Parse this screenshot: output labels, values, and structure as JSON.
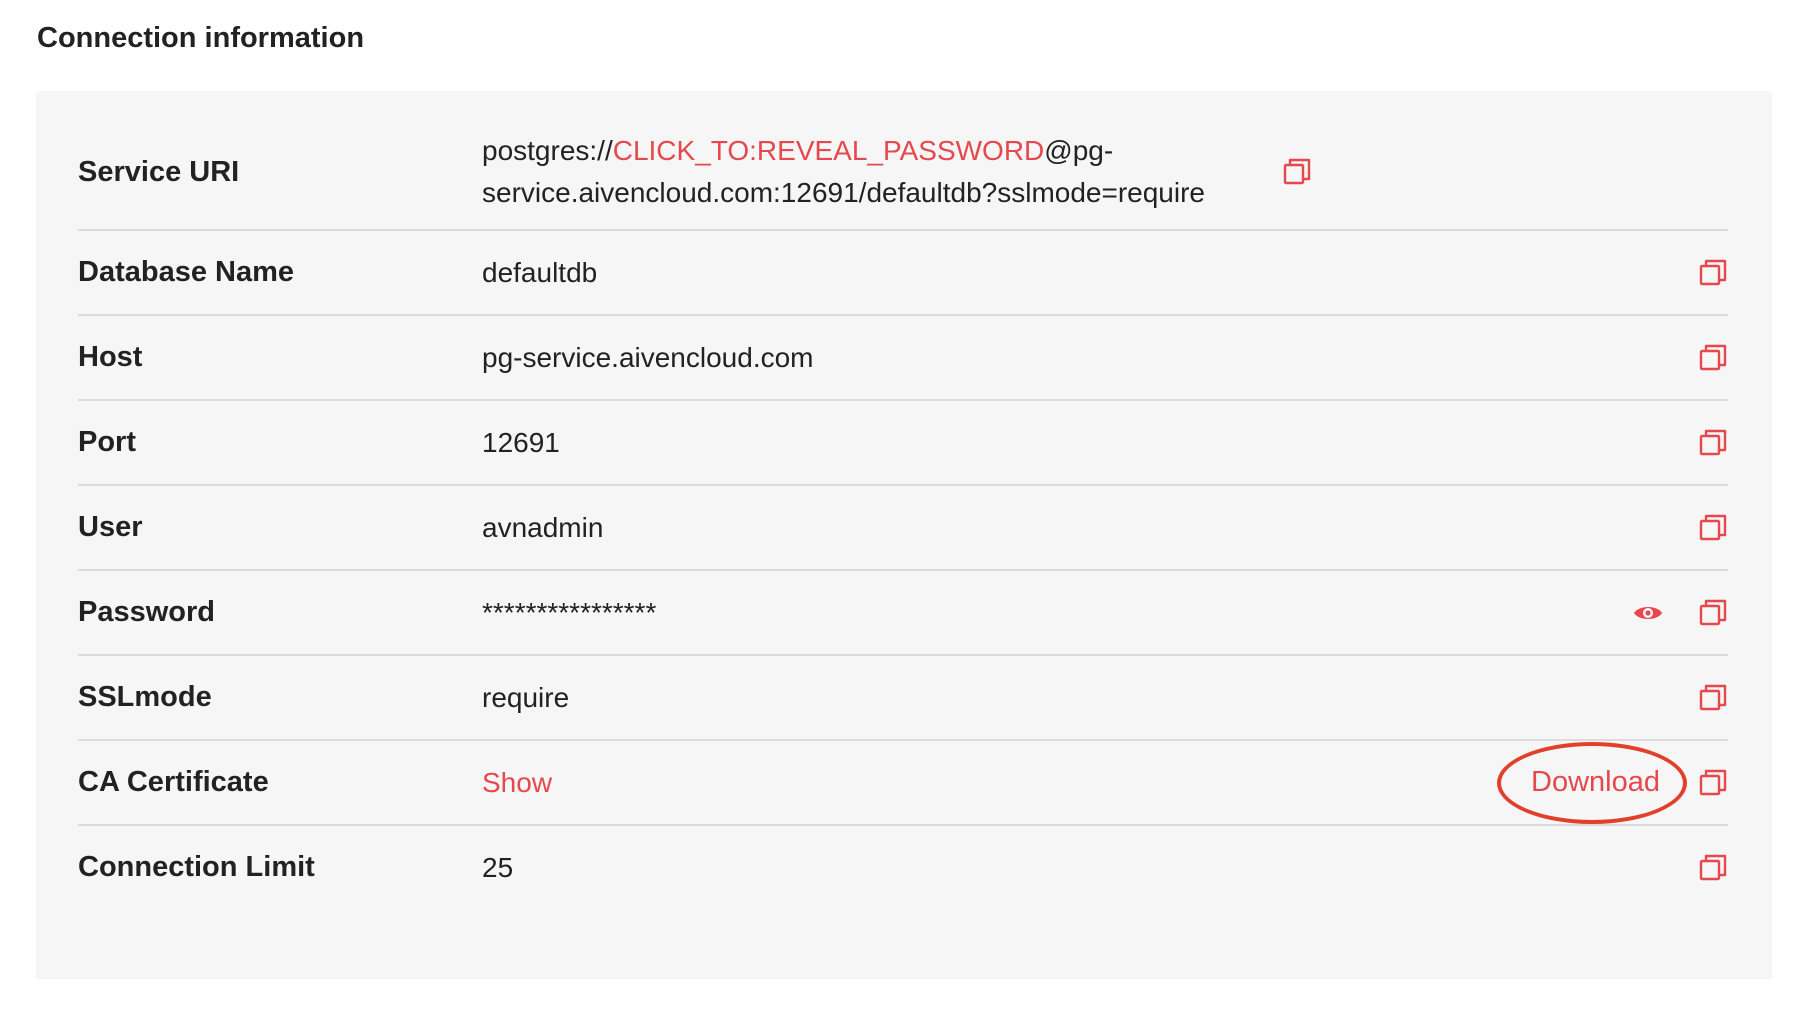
{
  "section": {
    "title": "Connection information"
  },
  "rows": {
    "service_uri": {
      "label": "Service URI",
      "value_prefix": "postgres://",
      "value_secret": "CLICK_TO:REVEAL_PASSWORD",
      "value_suffix": "@pg-service.aivencloud.com:12691/defaultdb?sslmode=require"
    },
    "database_name": {
      "label": "Database Name",
      "value": "defaultdb"
    },
    "host": {
      "label": "Host",
      "value": "pg-service.aivencloud.com"
    },
    "port": {
      "label": "Port",
      "value": "12691"
    },
    "user": {
      "label": "User",
      "value": "avnadmin"
    },
    "password": {
      "label": "Password",
      "value": "****************"
    },
    "sslmode": {
      "label": "SSLmode",
      "value": "require"
    },
    "ca_certificate": {
      "label": "CA Certificate",
      "show_label": "Show",
      "download_label": "Download"
    },
    "connection_limit": {
      "label": "Connection Limit",
      "value": "25"
    }
  },
  "icons": {
    "copy": "copy-icon",
    "reveal": "eye-icon"
  },
  "colors": {
    "accent": "#e5484d",
    "annotation": "#e0402c",
    "panel_bg": "#f6f6f6",
    "divider": "#dcdcdc",
    "text": "#222222"
  }
}
